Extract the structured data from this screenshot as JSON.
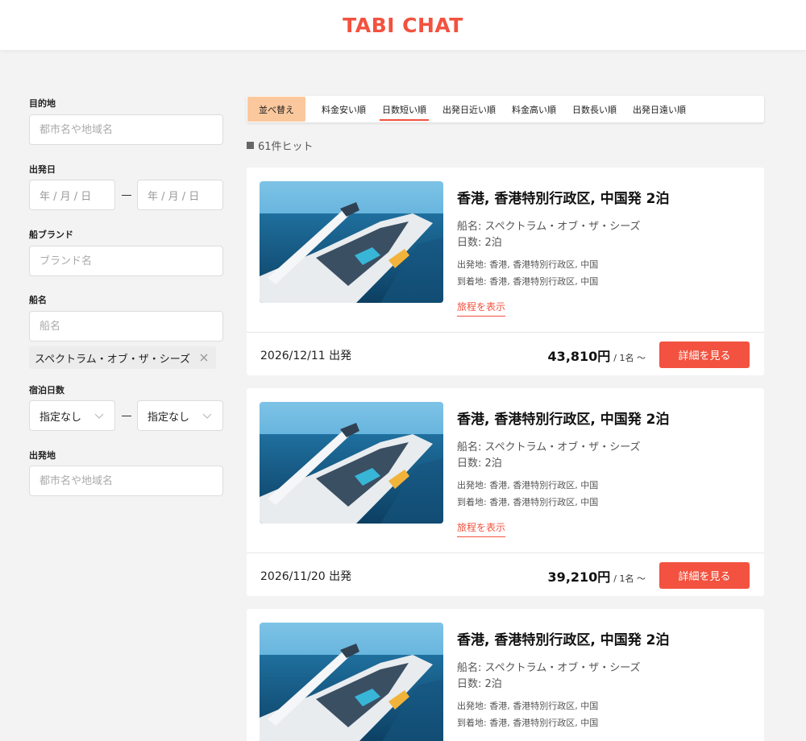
{
  "header": {
    "logo": "TABI CHAT"
  },
  "sidebar": {
    "destination": {
      "label": "目的地",
      "placeholder": "都市名や地域名"
    },
    "departure_date": {
      "label": "出発日",
      "from_placeholder": "年 / 月 / 日",
      "to_placeholder": "年 / 月 / 日"
    },
    "brand": {
      "label": "船ブランド",
      "placeholder": "ブランド名"
    },
    "ship": {
      "label": "船名",
      "placeholder": "船名",
      "selected_chip": "スペクトラム・オブ・ザ・シーズ"
    },
    "nights": {
      "label": "宿泊日数",
      "from_value": "指定なし",
      "to_value": "指定なし"
    },
    "departure_port": {
      "label": "出発地",
      "placeholder": "都市名や地域名"
    }
  },
  "sort": {
    "label": "並べ替え",
    "options": [
      "料金安い順",
      "日数短い順",
      "出発日近い順",
      "料金高い順",
      "日数長い順",
      "出発日遠い順"
    ],
    "active_index": 1
  },
  "hits": "61件ヒット",
  "cards": [
    {
      "title": "香港, 香港特別行政区, 中国発 2泊",
      "ship": "船名: スペクトラム・オブ・ザ・シーズ",
      "days": "日数: 2泊",
      "departure": "出発地: 香港, 香港特別行政区, 中国",
      "arrival": "到着地: 香港, 香港特別行政区, 中国",
      "link": "旅程を表示",
      "date": "2026/12/11 出発",
      "price": "43,810円",
      "price_unit": "/ 1名 〜",
      "button": "詳細を見る"
    },
    {
      "title": "香港, 香港特別行政区, 中国発 2泊",
      "ship": "船名: スペクトラム・オブ・ザ・シーズ",
      "days": "日数: 2泊",
      "departure": "出発地: 香港, 香港特別行政区, 中国",
      "arrival": "到着地: 香港, 香港特別行政区, 中国",
      "link": "旅程を表示",
      "date": "2026/11/20 出発",
      "price": "39,210円",
      "price_unit": "/ 1名 〜",
      "button": "詳細を見る"
    },
    {
      "title": "香港, 香港特別行政区, 中国発 2泊",
      "ship": "船名: スペクトラム・オブ・ザ・シーズ",
      "days": "日数: 2泊",
      "departure": "出発地: 香港, 香港特別行政区, 中国",
      "arrival": "到着地: 香港, 香港特別行政区, 中国"
    }
  ],
  "colors": {
    "accent": "#f2523f",
    "sort_label_bg": "#fbc89e",
    "page_bg": "#f3f3f3"
  }
}
